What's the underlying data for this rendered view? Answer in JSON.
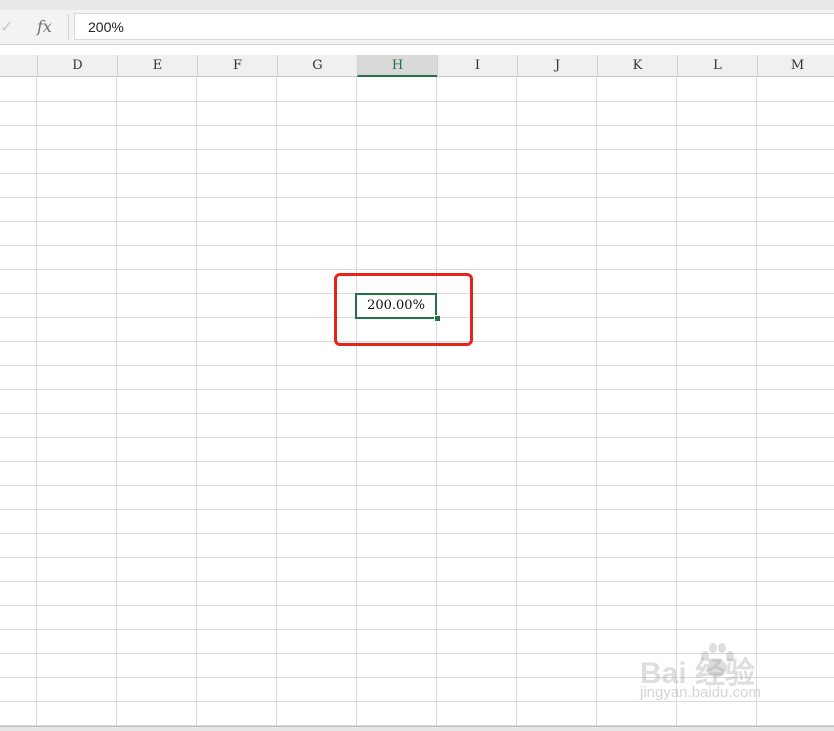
{
  "formula_bar": {
    "check_glyph": "✓",
    "fx_label": "fx",
    "value": "200%"
  },
  "columns": [
    "",
    "D",
    "E",
    "F",
    "G",
    "H",
    "I",
    "J",
    "K",
    "L",
    "M"
  ],
  "selected_column": "H",
  "active_cell": {
    "display": "200.00%"
  },
  "watermark": {
    "main": "Bai  经验",
    "sub": "jingyan.baidu.com"
  },
  "colors": {
    "accent": "#217346",
    "annotation": "#e8231b"
  }
}
